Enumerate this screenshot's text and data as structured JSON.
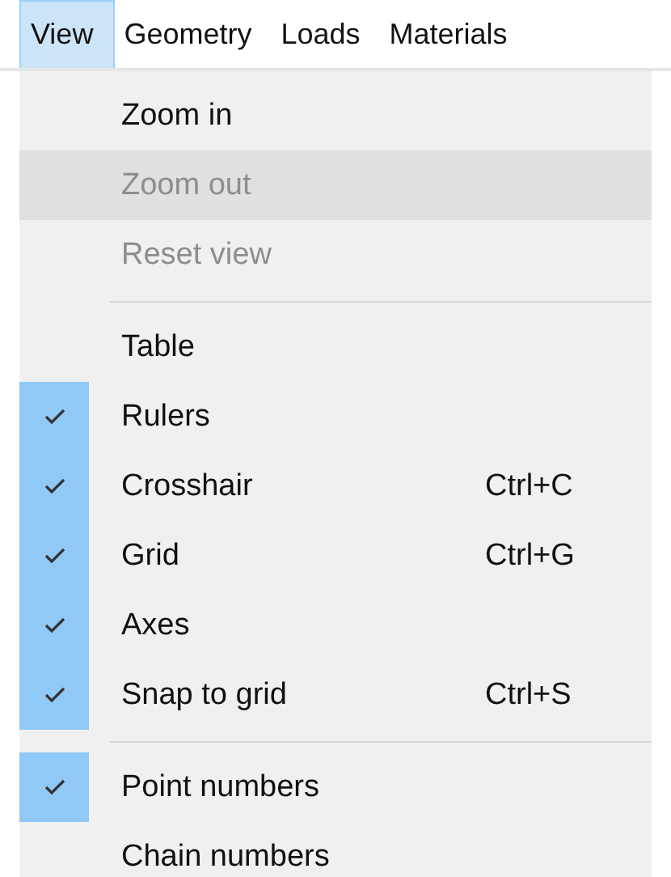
{
  "menubar": [
    {
      "label": "View",
      "selected": true
    },
    {
      "label": "Geometry",
      "selected": false
    },
    {
      "label": "Loads",
      "selected": false
    },
    {
      "label": "Materials",
      "selected": false
    }
  ],
  "menu": [
    {
      "kind": "item",
      "label": "Zoom in",
      "disabled": false,
      "checked": false,
      "highlighted": false
    },
    {
      "kind": "item",
      "label": "Zoom out",
      "disabled": true,
      "checked": false,
      "highlighted": true
    },
    {
      "kind": "item",
      "label": "Reset view",
      "disabled": true,
      "checked": false,
      "highlighted": false
    },
    {
      "kind": "separator"
    },
    {
      "kind": "item",
      "label": "Table",
      "disabled": false,
      "checked": false,
      "highlighted": false
    },
    {
      "kind": "item",
      "label": "Rulers",
      "disabled": false,
      "checked": true,
      "highlighted": false
    },
    {
      "kind": "item",
      "label": "Crosshair",
      "shortcut": "Ctrl+C",
      "disabled": false,
      "checked": true,
      "highlighted": false
    },
    {
      "kind": "item",
      "label": "Grid",
      "shortcut": "Ctrl+G",
      "disabled": false,
      "checked": true,
      "highlighted": false
    },
    {
      "kind": "item",
      "label": "Axes",
      "disabled": false,
      "checked": true,
      "highlighted": false
    },
    {
      "kind": "item",
      "label": "Snap to grid",
      "shortcut": "Ctrl+S",
      "disabled": false,
      "checked": true,
      "highlighted": false
    },
    {
      "kind": "separator"
    },
    {
      "kind": "item",
      "label": "Point numbers",
      "disabled": false,
      "checked": true,
      "highlighted": false
    },
    {
      "kind": "item",
      "label": "Chain numbers",
      "disabled": false,
      "checked": false,
      "highlighted": false
    }
  ]
}
